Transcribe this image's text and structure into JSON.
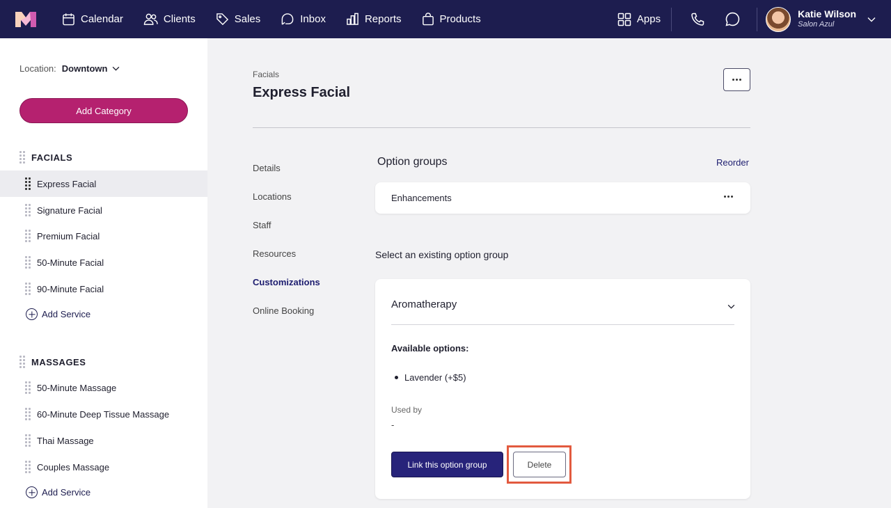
{
  "nav": {
    "items": [
      {
        "label": "Calendar",
        "icon": "calendar-icon"
      },
      {
        "label": "Clients",
        "icon": "clients-icon"
      },
      {
        "label": "Sales",
        "icon": "tag-icon"
      },
      {
        "label": "Inbox",
        "icon": "inbox-icon"
      },
      {
        "label": "Reports",
        "icon": "reports-icon"
      },
      {
        "label": "Products",
        "icon": "bag-icon"
      }
    ],
    "apps_label": "Apps",
    "user_name": "Katie Wilson",
    "salon_name": "Salon Azul"
  },
  "sidebar": {
    "location_label": "Location:",
    "location_value": "Downtown",
    "add_category": "Add Category",
    "categories": [
      {
        "name": "FACIALS",
        "services": [
          "Express Facial",
          "Signature Facial",
          "Premium Facial",
          "50-Minute Facial",
          "90-Minute Facial"
        ],
        "add_service": "Add Service"
      },
      {
        "name": "MASSAGES",
        "services": [
          "50-Minute Massage",
          "60-Minute Deep Tissue Massage",
          "Thai Massage",
          "Couples Massage"
        ],
        "add_service": "Add Service"
      }
    ]
  },
  "main": {
    "breadcrumb": "Facials",
    "title": "Express Facial",
    "subnav": [
      "Details",
      "Locations",
      "Staff",
      "Resources",
      "Customizations",
      "Online Booking"
    ],
    "active_subnav": "Customizations",
    "option_groups_title": "Option groups",
    "reorder": "Reorder",
    "group_name": "Enhancements",
    "select_existing": "Select an existing option group",
    "existing_group": {
      "name": "Aromatherapy",
      "available_label": "Available options:",
      "options": [
        "Lavender (+$5)"
      ],
      "used_by_label": "Used by",
      "used_by_value": "-",
      "link_button": "Link this option group",
      "delete_button": "Delete"
    }
  },
  "colors": {
    "nav_bg": "#1d1d4f",
    "add_category_bg": "#b5216f",
    "primary_button": "#27237a",
    "highlight": "#e25a3f"
  }
}
